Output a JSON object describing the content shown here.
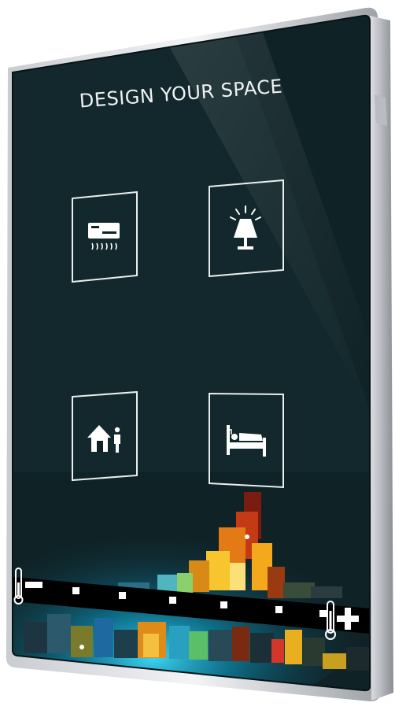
{
  "title": "DESIGN YOUR SPACE",
  "colors": {
    "glass": "#0f2226",
    "glass_edge": "#071316",
    "frame": "#d6d9dd",
    "icon": "#ffffff",
    "slider_bar": "#000000",
    "glow": "#16b3e0"
  },
  "buttons": [
    {
      "icon": "air-conditioner-icon"
    },
    {
      "icon": "lamp-icon"
    },
    {
      "icon": "home-presence-icon"
    },
    {
      "icon": "bed-icon"
    }
  ],
  "slider": {
    "decrease_symbol": "−",
    "increase_symbol": "+",
    "step_marks": 6,
    "min_icon": "thermometer-icon",
    "max_icon": "thermometer-icon"
  }
}
